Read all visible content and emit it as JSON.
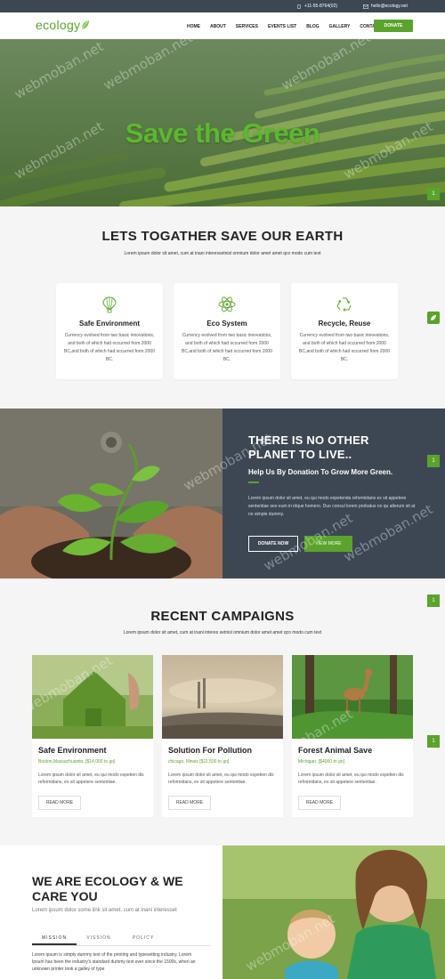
{
  "topbar": {
    "phone": "+11-55-8764(02)",
    "email": "hello@ecology.net"
  },
  "header": {
    "logo": "ecology",
    "nav": [
      "HOME",
      "ABOUT",
      "SERVICES",
      "EVENTS LIST",
      "BLOG",
      "GALLERY",
      "CONTACT US"
    ],
    "donate_label": "DONATE"
  },
  "hero": {
    "title": "Save the Green",
    "side_tab": "1"
  },
  "save": {
    "title": "LETS TOGATHER SAVE OUR EARTH",
    "subtitle": "Lorem ipsum dolor sit amet, cum at inani interessetnisl omnium dolor amet amet qco modo cum text",
    "cards": [
      {
        "icon": "balloon-icon",
        "title": "Safe Environment",
        "text": "Currency evolved from two basic innovations, and both of which had occurred from 2000 BC,and both of which had occurred from 2000 BC."
      },
      {
        "icon": "atom-icon",
        "title": "Eco System",
        "text": "Currency evolved from two basic innovations, and both of which had occurred from 2000 BC,and both of which had occurred from 2000 BC."
      },
      {
        "icon": "recycle-icon",
        "title": "Recycle, Reuse",
        "text": "Currency evolved from two basic innovations, and both of which had occurred from 2000 BC,and both of which had occurred from 2000 BC."
      }
    ]
  },
  "donation": {
    "title": "THERE IS NO OTHER PLANET TO LIVE..",
    "subtitle": "Help Us By Donation To Grow More Green.",
    "text": "Lorem ipsum dolor sit amet, eu qui modo expetenda reformidans ex sit appetere sententiae seo eum in idque homero. Duo consul lorem probatus no qu alterum sit at no simple dummy.",
    "donate_btn": "DONATE NOW",
    "view_btn": "VIEW MORE",
    "side_tab": "1"
  },
  "campaigns": {
    "title": "RECENT CAMPAIGNS",
    "subtitle": "Lorem ipsum dolor sit amet, cum at inani interes setnisl omnium dolor amet amet qco modo cum text",
    "side_tab": "1",
    "items": [
      {
        "title": "Safe Environment",
        "meta": "Boston,Massachusetts. [$14,000 to go]",
        "text": "Lorem ipsum dolor sit amet, eu qui modo expetien dis reformidans, ex sit appetere sententiae.",
        "btn": "READ MORE"
      },
      {
        "title": "Solution For Pollution",
        "meta": "chicago, Illinois [$11,500 to go]",
        "text": "Lorem ipsum dolor sit amet, eu qui modo expetien dis reformidans, ex sit appetere sententiae.",
        "btn": "READ MORE"
      },
      {
        "title": "Forest Animal Save",
        "meta": "Michigan. [$4000 to go]",
        "text": "Lorem ipsum dolor sit amet, eu qui modo expetien dis reformidans, ex sit appetere sententiae.",
        "btn": "READ MORE"
      }
    ]
  },
  "about": {
    "title": "WE ARE ECOLOGY & WE CARE YOU",
    "subtitle": "Lorem ipsum dolor some link sit amet, cum at inani interesset",
    "tabs": [
      "MISSION",
      "VISSION",
      "POLICY"
    ],
    "text": "Lorem ipsum is simply dummy text of the printing and typesetting industry. Lorem Ipsum has been the industry's standard dummy text ever since the 1500s, when an unknown printer took a galley of type"
  },
  "watermark": "webmoban.net",
  "colors": {
    "accent": "#5aa32c",
    "dark": "#3c4753",
    "bg_light": "#f5f5f5"
  }
}
